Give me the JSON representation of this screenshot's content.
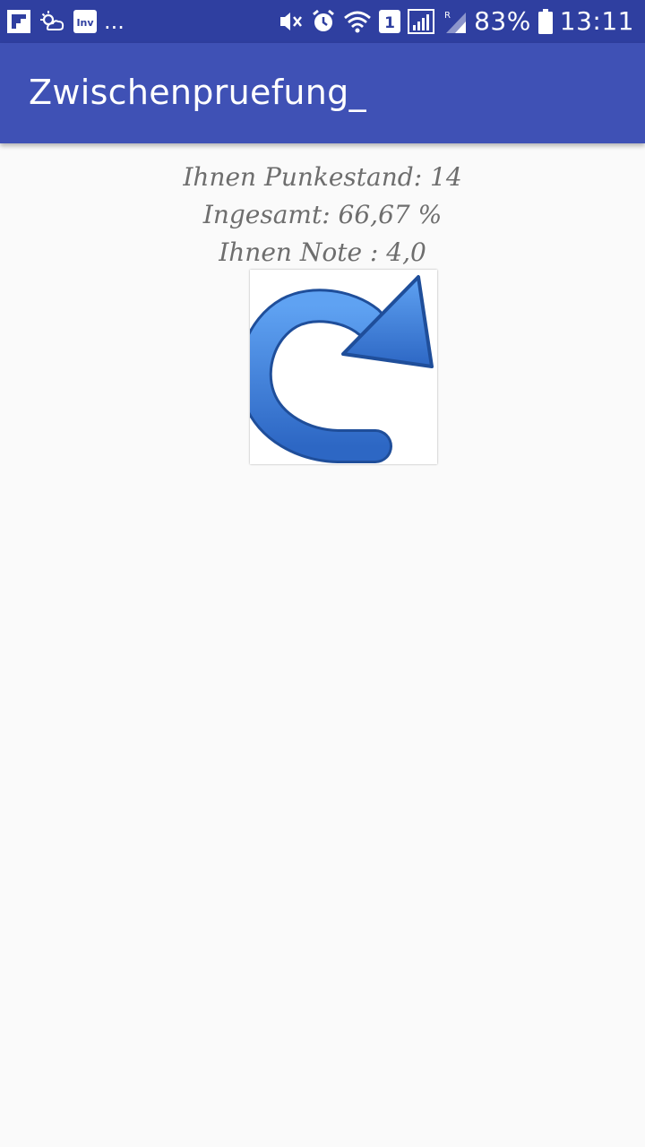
{
  "status_bar": {
    "notification_icons": [
      "flipboard-icon",
      "weather-icon",
      "inv-icon"
    ],
    "inv_label": "Inv",
    "more_indicator": "...",
    "sim_label": "1",
    "battery_percent": "83%",
    "time": "13:11",
    "colors": {
      "background": "#2f3fa0",
      "foreground": "#ffffff"
    }
  },
  "app_bar": {
    "title": "Zwischenpruefung_",
    "color": "#3f51b5"
  },
  "results": {
    "score_text": "Ihnen Punkestand: 14",
    "total_text": "Ingesamt: 66,67 %",
    "grade_text": "Ihnen Note : 4,0"
  },
  "retry": {
    "icon": "redo-arrow-icon",
    "arrow_color": "#3d82e0"
  }
}
